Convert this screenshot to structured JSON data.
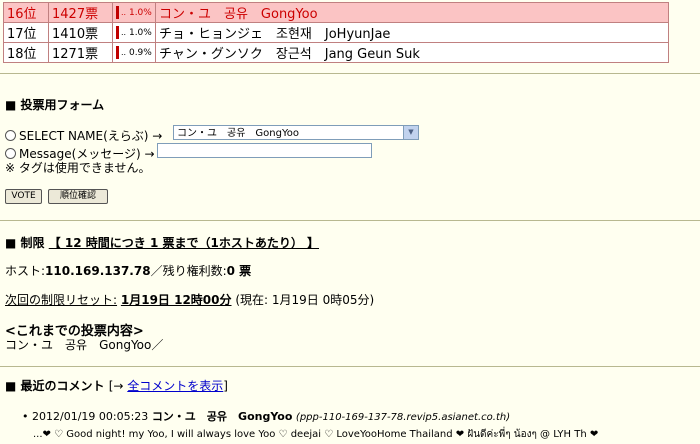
{
  "ranking": [
    {
      "rank": "16位",
      "votes": "1427票",
      "percent": "1.0%",
      "name": "コン・ユ　공유　GongYoo",
      "highlight": true
    },
    {
      "rank": "17位",
      "votes": "1410票",
      "percent": "1.0%",
      "name": "チョ・ヒョンジェ　조현재　JoHyunJae",
      "highlight": false
    },
    {
      "rank": "18位",
      "votes": "1271票",
      "percent": "0.9%",
      "name": "チャン・グンソク　장근석　Jang Geun Suk",
      "highlight": false
    }
  ],
  "vote_form": {
    "title": "投票用フォーム",
    "select_label": "SELECT NAME(えらぶ) →",
    "select_value": "コン・ユ　공유　GongYoo",
    "message_label": "Message(メッセージ) →",
    "message_value": "",
    "note": "※ タグは使用できません。",
    "vote_button": "VOTE",
    "rank_button": "順位確認"
  },
  "limit": {
    "title": "制限",
    "rule": "【 12 時間につき 1 票まで（1ホストあたり） 】",
    "host_label": "ホスト:",
    "host_value": "110.169.137.78",
    "remaining_label": "／残り権利数:",
    "remaining_value": "0 票",
    "reset_label": "次回の制限リセット:",
    "reset_value": "1月19日 12時00分",
    "current_time": "(現在: 1月19日 0時05分)",
    "history_title": "<これまでの投票内容>",
    "history_value": "コン・ユ　공유　GongYoo／"
  },
  "comments": {
    "title": "最近のコメント",
    "link_prefix": "[→ ",
    "link_text": "全コメントを表示",
    "link_suffix": "]",
    "items": [
      {
        "date": "2012/01/19 00:05:23",
        "name": "コン・ユ　공유　GongYoo",
        "host": "(ppp-110-169-137-78.revip5.asianet.co.th)",
        "text": "...❤ ♡ Good night! my Yoo, I will always love Yoo ♡ deejai ♡ LoveYooHome Thailand ❤ ฝันดีค่ะพี่ๆ น้องๆ @ LYH Th ❤"
      }
    ]
  }
}
